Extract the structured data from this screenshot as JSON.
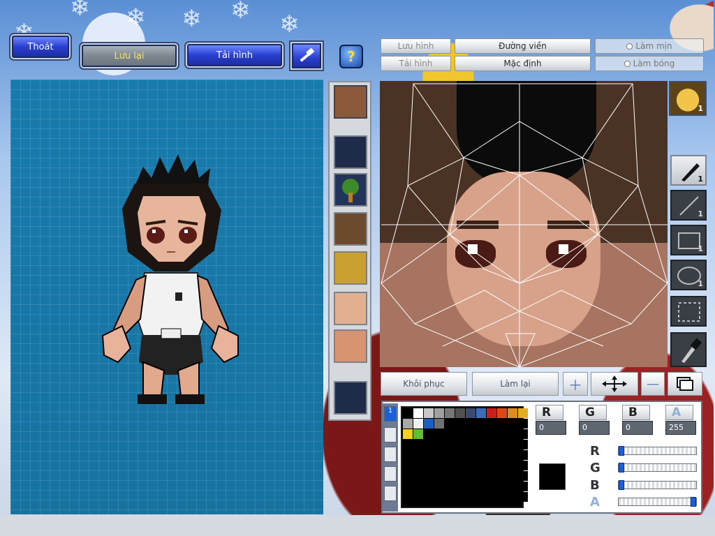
{
  "top_buttons": {
    "exit": "Thoát",
    "save": "Lưu lại",
    "reload_image": "Tải hình"
  },
  "tabs": {
    "save_image": "Lưu hình",
    "load_image": "Tải hình",
    "outline": "Đường viền",
    "default": "Mặc định",
    "smooth": "Làm mịn",
    "shade": "Làm bóng"
  },
  "tool_counts": {
    "face": "1",
    "pen": "1",
    "line": "1",
    "rect": "1",
    "ellipse": "1"
  },
  "actions": {
    "restore": "Khôi phục",
    "redo": "Làm lại"
  },
  "color": {
    "r_label": "R",
    "g_label": "G",
    "b_label": "B",
    "a_label": "A",
    "r_value": "0",
    "g_value": "0",
    "b_value": "0",
    "a_value": "255",
    "r_level": 0,
    "g_level": 0,
    "b_level": 0,
    "a_level": 1.0,
    "current": "#000000"
  },
  "palette_tab_active": "1",
  "palette_colors": [
    "#000000",
    "#ffffff",
    "#c8c8c8",
    "#a0a0a0",
    "#787878",
    "#505050",
    "#3c4a6e",
    "#3a6eb8",
    "#c82020",
    "#e04a10",
    "#e08a20",
    "#e0b020",
    "#a8a8a8",
    "#f0f0f0",
    "#1a5ec0",
    "#707070",
    "#000000",
    "#000000",
    "#000000",
    "#000000",
    "#000000",
    "#000000",
    "#000000",
    "#000000",
    "#f0d020",
    "#60c030",
    "#000000",
    "#000000",
    "#000000",
    "#000000",
    "#000000",
    "#000000",
    "#000000",
    "#000000",
    "#000000",
    "#000000"
  ],
  "colors": {
    "button_blue": "#2a3fd0",
    "preview_bg": "#1a82b6"
  }
}
